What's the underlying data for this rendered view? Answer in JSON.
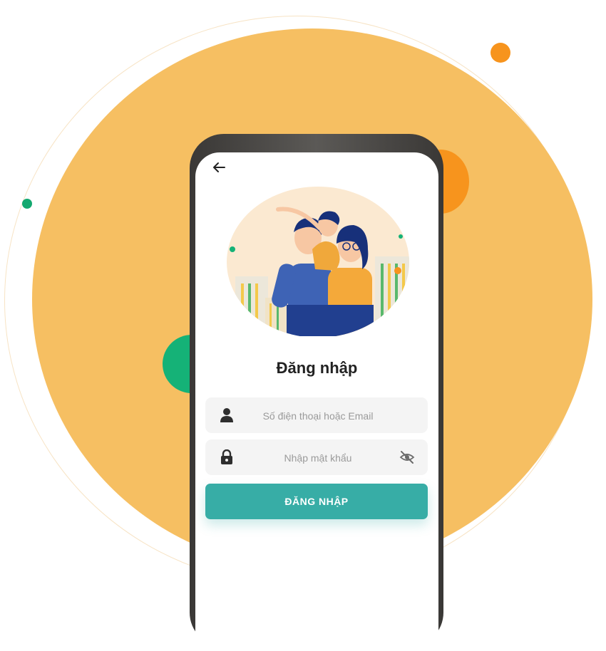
{
  "login": {
    "title": "Đăng nhập",
    "phone_placeholder": "Số điện thoại hoặc Email",
    "password_placeholder": "Nhập mật khẩu",
    "submit_label": "ĐĂNG NHẬP"
  },
  "icons": {
    "back": "arrow-left-icon",
    "user": "user-icon",
    "lock": "lock-icon",
    "toggle_visibility": "eye-off-icon"
  },
  "colors": {
    "background_blob": "#f6bf62",
    "accent_orange": "#f7941d",
    "accent_green": "#15b277",
    "button_teal": "#37ada6"
  }
}
